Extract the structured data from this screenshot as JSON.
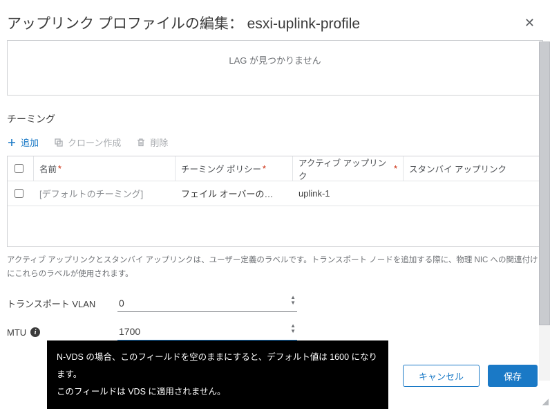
{
  "dialog": {
    "title": "アップリンク プロファイルの編集： esxi-uplink-profile"
  },
  "lag": {
    "empty": "LAG が見つかりません"
  },
  "teaming": {
    "section_title": "チーミング",
    "toolbar": {
      "add": "追加",
      "clone": "クローン作成",
      "delete": "削除"
    },
    "columns": {
      "name": "名前",
      "policy": "チーミング ポリシー",
      "active": "アクティブ アップリンク",
      "standby": "スタンバイ アップリンク"
    },
    "rows": [
      {
        "name": "[デフォルトのチーミング]",
        "policy": "フェイル オーバーの…",
        "active": "uplink-1",
        "standby": ""
      }
    ],
    "help": "アクティブ アップリンクとスタンバイ アップリンクは、ユーザー定義のラベルです。トランスポート ノードを追加する際に、物理 NIC への関連付けにこれらのラベルが使用されます。"
  },
  "fields": {
    "transport_vlan": {
      "label": "トランスポート VLAN",
      "value": "0"
    },
    "mtu": {
      "label": "MTU",
      "value": "1700"
    }
  },
  "tooltip": {
    "line1": "N-VDS の場合、このフィールドを空のままにすると、デフォルト値は 1600 になります。",
    "line2": "このフィールドは VDS に適用されません。"
  },
  "footer": {
    "cancel": "キャンセル",
    "save": "保存"
  }
}
